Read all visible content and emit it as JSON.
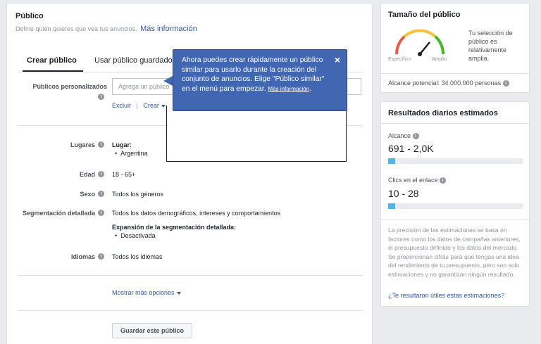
{
  "audience": {
    "title": "Público",
    "subtitle": "Define quién quieres que vea tus anuncios.",
    "more_info": "Más información",
    "tabs": [
      {
        "label": "Crear público",
        "active": true
      },
      {
        "label": "Usar público guardado",
        "active": false
      }
    ],
    "custom_audiences": {
      "label": "Públicos personalizados",
      "placeholder": "Agrega un público",
      "exclude": "Excluir",
      "separator": "|",
      "create": "Crear"
    },
    "locations": {
      "label": "Lugares",
      "sublabel": "Lugar:",
      "value": "Argentina"
    },
    "age": {
      "label": "Edad",
      "value": "18 - 65+"
    },
    "gender": {
      "label": "Sexo",
      "value": "Todos los géneros"
    },
    "detailed_targeting": {
      "label": "Segmentación detallada",
      "value": "Todos los datos demográficos, intereses y comportamientos",
      "expansion_label": "Expansión de la segmentación detallada:",
      "expansion_value": "Desactivada"
    },
    "languages": {
      "label": "Idiomas",
      "value": "Todos los idiomas"
    },
    "more_options": "Mostrar más opciones",
    "save_button": "Guardar este público"
  },
  "tooltip": {
    "text": "Ahora puedes crear rápidamente un público similar para usarlo durante la creación del conjunto de anuncios. Elige \"Público similar\" en el menú para empezar.",
    "link": "Más información",
    "link_suffix": ".",
    "close": "×"
  },
  "audience_size": {
    "title": "Tamaño del público",
    "gauge_left": "Específico",
    "gauge_right": "Amplio",
    "description": "Tu selección de público es relativamente amplia.",
    "reach": "Alcance potencial: 34.000.000 personas",
    "gauge_level": 0.72,
    "colors": {
      "red": "#e65c4f",
      "yellow": "#f5c33b",
      "green": "#42b72a"
    }
  },
  "daily_results": {
    "title": "Resultados diarios estimados",
    "reach_label": "Alcance",
    "reach_value": "691 - 2,0K",
    "reach_level": 0.05,
    "clicks_label": "Clics en el enlace",
    "clicks_value": "10 - 28",
    "clicks_level": 0.05,
    "note": "La precisión de las estimaciones se basa en factores como los datos de campañas anteriores, el presupuesto definido y los datos del mercado. Se proporcionan cifras para que tengas una idea del rendimiento de tu presupuesto, pero son solo estimaciones y no garantizan ningún resultado.",
    "feedback_link": "¿Te resultaron útiles estas estimaciones?"
  }
}
